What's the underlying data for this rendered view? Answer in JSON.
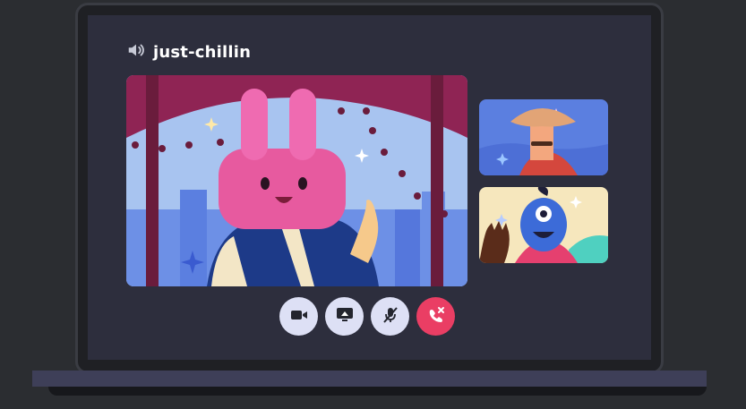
{
  "channel": {
    "name": "just-chillin",
    "icon": "speaker-icon"
  },
  "video_tiles": [
    {
      "participant": "pink-bunny-avatar"
    },
    {
      "participant": "mushroom-hat-avatar"
    },
    {
      "participant": "blue-ogre-avatar"
    }
  ],
  "controls": [
    {
      "name": "camera-button",
      "icon": "video-camera-icon"
    },
    {
      "name": "screen-share-button",
      "icon": "screen-share-icon"
    },
    {
      "name": "mute-button",
      "icon": "muted-microphone-icon"
    },
    {
      "name": "end-call-button",
      "icon": "hang-up-icon"
    }
  ],
  "colors": {
    "background": "#2b2d31",
    "screen": "#2d2e3d",
    "control_button": "#dde0f5",
    "end_call": "#ea3e64",
    "title_text": "#ffffff"
  }
}
